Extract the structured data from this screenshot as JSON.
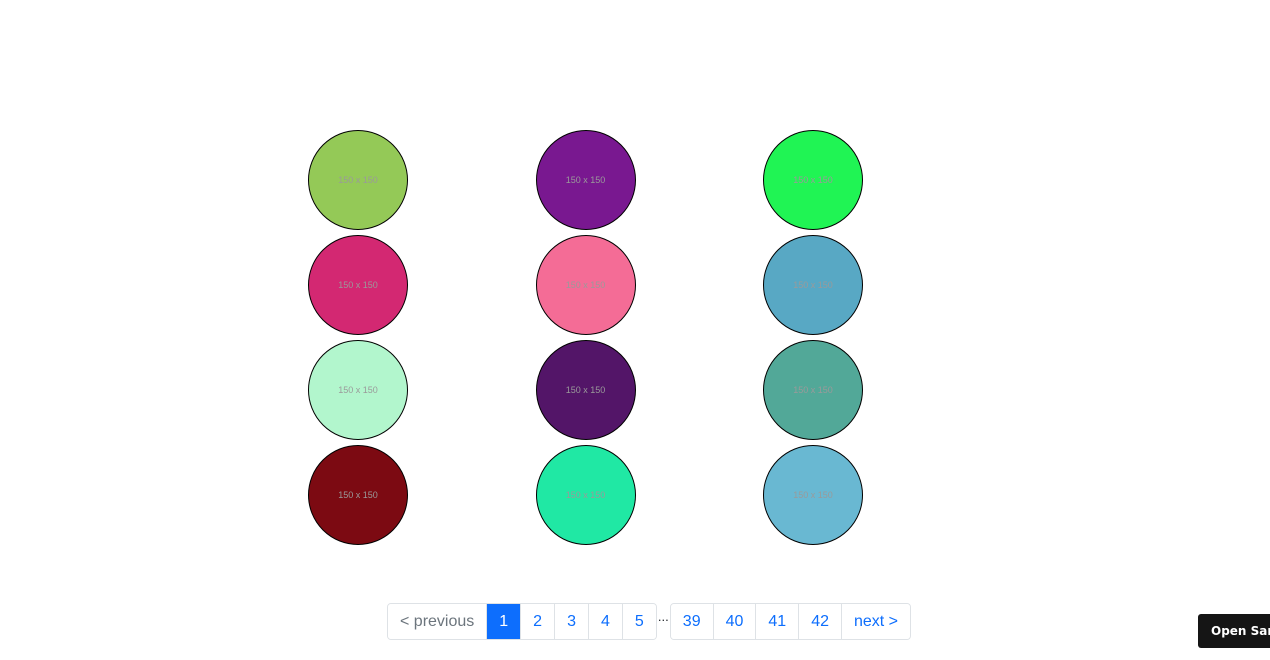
{
  "grid": {
    "items": [
      {
        "label": "150 x 150",
        "color": "#94c957"
      },
      {
        "label": "150 x 150",
        "color": "#791890"
      },
      {
        "label": "150 x 150",
        "color": "#20f454"
      },
      {
        "label": "150 x 150",
        "color": "#d32872"
      },
      {
        "label": "150 x 150",
        "color": "#f46c96"
      },
      {
        "label": "150 x 150",
        "color": "#58a8c4"
      },
      {
        "label": "150 x 150",
        "color": "#b2f6cd"
      },
      {
        "label": "150 x 150",
        "color": "#531568"
      },
      {
        "label": "150 x 150",
        "color": "#52a898"
      },
      {
        "label": "150 x 150",
        "color": "#7c0a12"
      },
      {
        "label": "150 x 150",
        "color": "#20e8a4"
      },
      {
        "label": "150 x 150",
        "color": "#69b8d2"
      }
    ]
  },
  "pagination": {
    "previous": "< previous",
    "pages_start": [
      "1",
      "2",
      "3",
      "4",
      "5"
    ],
    "ellipsis": "...",
    "pages_end": [
      "39",
      "40",
      "41",
      "42"
    ],
    "next": "next >",
    "active_page": "1",
    "accent_color": "#0d6efd"
  },
  "sandbox": {
    "label": "Open Sandbox"
  }
}
